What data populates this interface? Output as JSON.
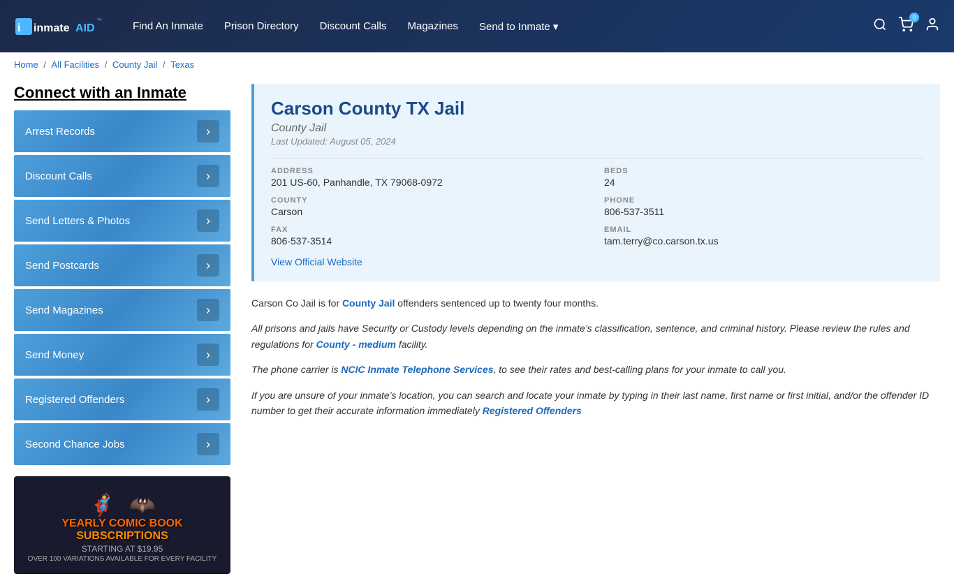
{
  "header": {
    "logo_text": "inmate",
    "logo_highlight": "AID",
    "nav": {
      "find_inmate": "Find An Inmate",
      "prison_directory": "Prison Directory",
      "discount_calls": "Discount Calls",
      "magazines": "Magazines",
      "send_to_inmate": "Send to Inmate ▾"
    },
    "cart_count": "0"
  },
  "breadcrumb": {
    "home": "Home",
    "all_facilities": "All Facilities",
    "county_jail": "County Jail",
    "texas": "Texas"
  },
  "sidebar": {
    "title": "Connect with an Inmate",
    "buttons": [
      "Arrest Records",
      "Discount Calls",
      "Send Letters & Photos",
      "Send Postcards",
      "Send Magazines",
      "Send Money",
      "Registered Offenders",
      "Second Chance Jobs"
    ],
    "ad": {
      "line1": "YEARLY COMIC BOOK",
      "line2": "SUBSCRIPTIONS",
      "price": "STARTING AT $19.95",
      "small": "OVER 100 VARIATIONS AVAILABLE FOR EVERY FACILITY"
    }
  },
  "facility": {
    "name": "Carson County TX Jail",
    "type": "County Jail",
    "updated": "Last Updated: August 05, 2024",
    "address_label": "ADDRESS",
    "address_value": "201 US-60, Panhandle, TX 79068-0972",
    "beds_label": "BEDS",
    "beds_value": "24",
    "county_label": "COUNTY",
    "county_value": "Carson",
    "phone_label": "PHONE",
    "phone_value": "806-537-3511",
    "fax_label": "FAX",
    "fax_value": "806-537-3514",
    "email_label": "EMAIL",
    "email_value": "tam.terry@co.carson.tx.us",
    "website_label": "View Official Website"
  },
  "description": {
    "para1_before": "Carson Co Jail is for ",
    "para1_link": "County Jail",
    "para1_after": " offenders sentenced up to twenty four months.",
    "para2": "All prisons and jails have Security or Custody levels depending on the inmate’s classification, sentence, and criminal history. Please review the rules and regulations for ",
    "para2_link": "County - medium",
    "para2_after": " facility.",
    "para3_before": "The phone carrier is ",
    "para3_link": "NCIC Inmate Telephone Services",
    "para3_after": ", to see their rates and best-calling plans for your inmate to call you.",
    "para4_before": "If you are unsure of your inmate’s location, you can search and locate your inmate by typing in their last name, first name or first initial, and/or the offender ID number to get their accurate information immediately ",
    "para4_link": "Registered Offenders"
  }
}
